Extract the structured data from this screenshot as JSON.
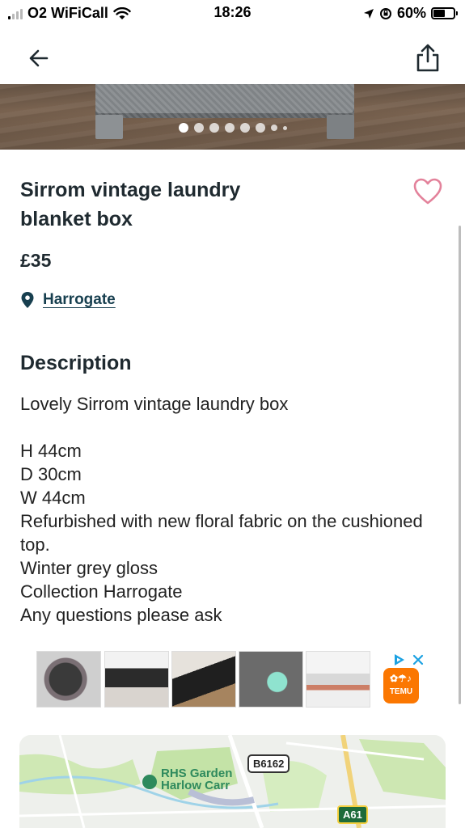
{
  "status_bar": {
    "carrier": "O2 WiFiCall",
    "time": "18:26",
    "battery_percent": "60%",
    "battery_level": 0.6,
    "signal_bars_active": 1,
    "icons": [
      "signal-icon",
      "wifi-icon",
      "location-arrow-icon",
      "orientation-lock-icon",
      "battery-icon"
    ]
  },
  "nav": {
    "back_icon": "arrow-left-icon",
    "share_icon": "share-icon"
  },
  "carousel": {
    "image_count_dots": 8,
    "active_index": 0
  },
  "listing": {
    "title": "Sirrom vintage laundry blanket box",
    "price": "£35",
    "location": "Harrogate",
    "favourite_icon": "heart-outline-icon"
  },
  "description": {
    "heading": "Description",
    "body": "Lovely Sirrom vintage laundry box\n\nH 44cm\nD 30cm\nW 44cm\nRefurbished with new floral fabric on the cushioned top.\nWinter grey gloss\nCollection Harrogate\nAny questions please ask"
  },
  "ad": {
    "brand": "TEMU",
    "image_count": 5,
    "icons": [
      "adchoices-icon",
      "close-icon"
    ]
  },
  "map": {
    "place_label": "RHS Garden\nHarlow Carr",
    "road_label_1": "B6162",
    "road_label_2": "A61"
  },
  "colors": {
    "text": "#1f2a30",
    "link": "#173f4f",
    "heart": "#e3829b",
    "accent_green": "#2e8a5d",
    "temu_orange": "#fb7701"
  }
}
